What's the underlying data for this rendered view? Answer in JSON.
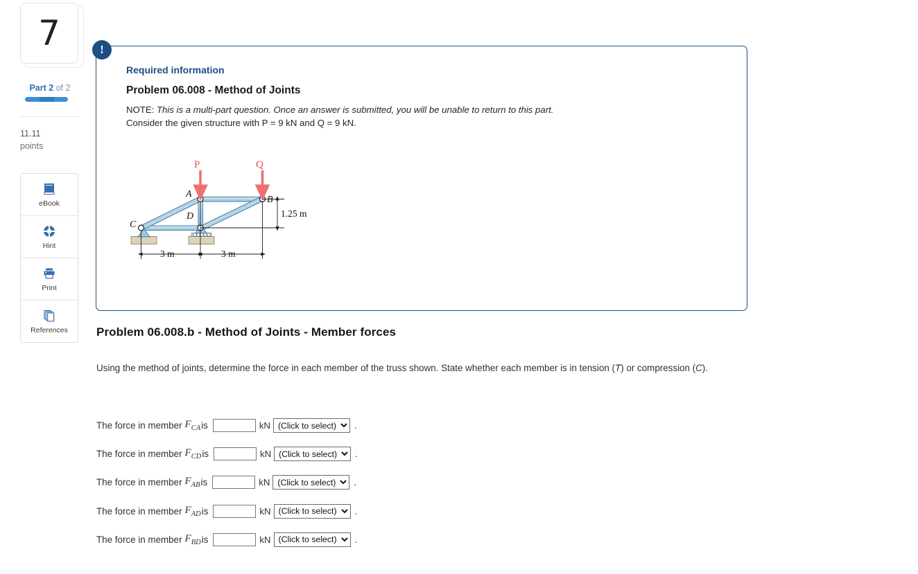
{
  "sidebar": {
    "question_number": "7",
    "part": {
      "prefix": "Part",
      "current": "2",
      "middle": "of",
      "total": "2"
    },
    "points_value": "11.11",
    "points_label": "points",
    "tools": [
      {
        "label": "eBook",
        "icon": "book-icon"
      },
      {
        "label": "Hint",
        "icon": "lifebuoy-icon"
      },
      {
        "label": "Print",
        "icon": "printer-icon"
      },
      {
        "label": "References",
        "icon": "copy-stack-icon"
      }
    ]
  },
  "required_info": {
    "badge": "!",
    "label": "Required information",
    "title": "Problem 06.008 - Method of Joints",
    "note_prefix": "NOTE:",
    "note_italic": "This is a multi-part question. Once an answer is submitted, you will be unable to return to this part.",
    "note_second_line": "Consider the given structure with P = 9 kN and Q = 9 kN."
  },
  "figure": {
    "load_p": "P",
    "load_q": "Q",
    "joints": [
      "A",
      "B",
      "C",
      "D"
    ],
    "height_dim": "1.25 m",
    "span_left": "3 m",
    "span_right": "3 m",
    "supports": {
      "C": "pin-support",
      "D": "roller-support"
    }
  },
  "question": {
    "heading": "Problem 06.008.b - Method of Joints - Member forces",
    "prompt_part1": "Using the method of joints, determine the force in each member of the truss shown. State whether each member is in tension (",
    "prompt_t": "T",
    "prompt_part2": ") or compression (",
    "prompt_c": "C",
    "prompt_part3": ")."
  },
  "answers": {
    "row_prefix": "The force in member",
    "row_is": "is",
    "unit": "kN",
    "select_placeholder": "(Click to select)",
    "period": ".",
    "rows": [
      {
        "symbol": "F",
        "subscript": "CA",
        "value": ""
      },
      {
        "symbol": "F",
        "subscript": "CD",
        "value": ""
      },
      {
        "symbol": "F",
        "subscript": "AB",
        "value": ""
      },
      {
        "symbol": "F",
        "subscript": "AD",
        "value": ""
      },
      {
        "symbol": "F",
        "subscript": "BD",
        "value": ""
      }
    ]
  },
  "colors": {
    "accent_blue": "#1c4f82",
    "link_blue": "#2a6ebb",
    "load_arrow_red": "#ef7070",
    "member_fill": "#bcd9e8",
    "member_outline": "#2f6f96"
  }
}
